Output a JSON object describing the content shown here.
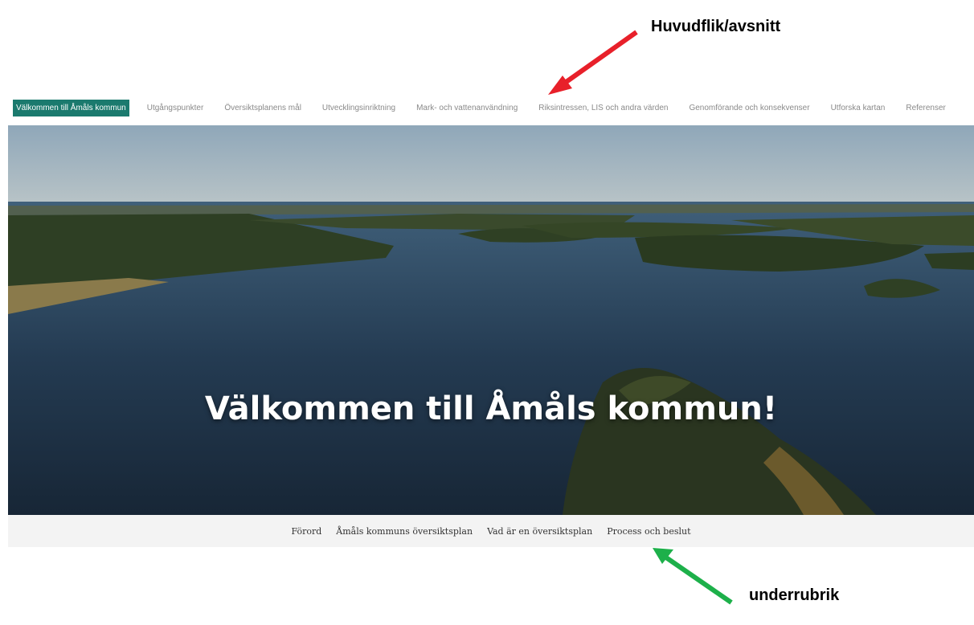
{
  "annotations": {
    "main_tab_label": "Huvudflik/avsnitt",
    "subheading_label": "underrubrik"
  },
  "topnav": {
    "tabs": [
      {
        "label": "Välkommen till Åmåls kommun",
        "active": true
      },
      {
        "label": "Utgångspunkter"
      },
      {
        "label": "Översiktsplanens mål"
      },
      {
        "label": "Utvecklingsinriktning"
      },
      {
        "label": "Mark- och vattenanvändning"
      },
      {
        "label": "Riksintressen, LIS och andra värden"
      },
      {
        "label": "Genomförande och konsekvenser"
      },
      {
        "label": "Utforska kartan"
      },
      {
        "label": "Referenser"
      }
    ]
  },
  "hero": {
    "title": "Välkommen till Åmåls kommun!"
  },
  "subnav": {
    "items": [
      {
        "label": "Förord"
      },
      {
        "label": "Åmåls kommuns översiktsplan"
      },
      {
        "label": "Vad är en översiktsplan"
      },
      {
        "label": "Process och beslut"
      }
    ]
  },
  "colors": {
    "accent": "#1b7a6e",
    "arrow_top": "#e8202a",
    "arrow_bottom": "#1db04a"
  }
}
